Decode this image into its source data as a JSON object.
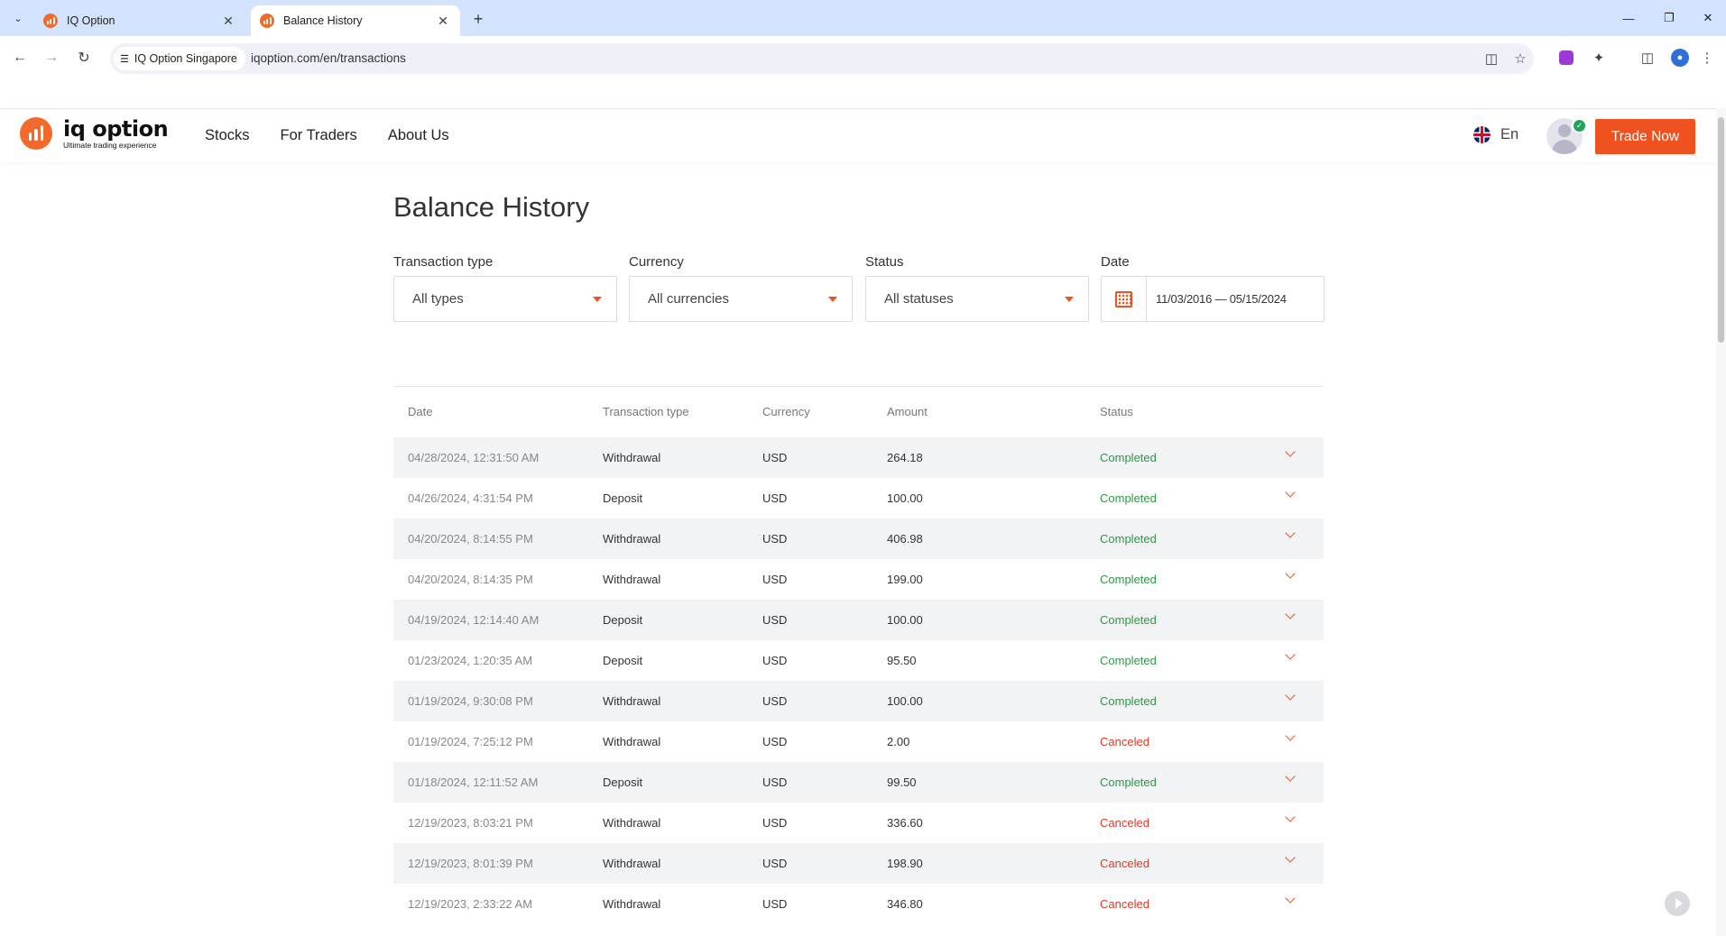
{
  "browser": {
    "tabs": [
      {
        "title": "IQ Option",
        "active": false
      },
      {
        "title": "Balance History",
        "active": true
      }
    ],
    "site_chip": "IQ Option Singapore",
    "url": "iqoption.com/en/transactions"
  },
  "header": {
    "logo_name": "iq option",
    "logo_tagline": "Ultimate trading experience",
    "nav": [
      "Stocks",
      "For Traders",
      "About Us"
    ],
    "language": "En",
    "cta": "Trade Now",
    "accent_color": "#f0521f"
  },
  "page": {
    "title": "Balance History",
    "filters": {
      "transaction_type": {
        "label": "Transaction type",
        "value": "All types"
      },
      "currency": {
        "label": "Currency",
        "value": "All currencies"
      },
      "status": {
        "label": "Status",
        "value": "All statuses"
      },
      "date": {
        "label": "Date",
        "value": "11/03/2016 — 05/15/2024"
      }
    },
    "table": {
      "headers": [
        "Date",
        "Transaction type",
        "Currency",
        "Amount",
        "Status"
      ],
      "rows": [
        {
          "date": "04/28/2024, 12:31:50 AM",
          "type": "Withdrawal",
          "currency": "USD",
          "amount": "264.18",
          "status": "Completed"
        },
        {
          "date": "04/26/2024, 4:31:54 PM",
          "type": "Deposit",
          "currency": "USD",
          "amount": "100.00",
          "status": "Completed"
        },
        {
          "date": "04/20/2024, 8:14:55 PM",
          "type": "Withdrawal",
          "currency": "USD",
          "amount": "406.98",
          "status": "Completed"
        },
        {
          "date": "04/20/2024, 8:14:35 PM",
          "type": "Withdrawal",
          "currency": "USD",
          "amount": "199.00",
          "status": "Completed"
        },
        {
          "date": "04/19/2024, 12:14:40 AM",
          "type": "Deposit",
          "currency": "USD",
          "amount": "100.00",
          "status": "Completed"
        },
        {
          "date": "01/23/2024, 1:20:35 AM",
          "type": "Deposit",
          "currency": "USD",
          "amount": "95.50",
          "status": "Completed"
        },
        {
          "date": "01/19/2024, 9:30:08 PM",
          "type": "Withdrawal",
          "currency": "USD",
          "amount": "100.00",
          "status": "Completed"
        },
        {
          "date": "01/19/2024, 7:25:12 PM",
          "type": "Withdrawal",
          "currency": "USD",
          "amount": "2.00",
          "status": "Canceled"
        },
        {
          "date": "01/18/2024, 12:11:52 AM",
          "type": "Deposit",
          "currency": "USD",
          "amount": "99.50",
          "status": "Completed"
        },
        {
          "date": "12/19/2023, 8:03:21 PM",
          "type": "Withdrawal",
          "currency": "USD",
          "amount": "336.60",
          "status": "Canceled"
        },
        {
          "date": "12/19/2023, 8:01:39 PM",
          "type": "Withdrawal",
          "currency": "USD",
          "amount": "198.90",
          "status": "Canceled"
        },
        {
          "date": "12/19/2023, 2:33:22 AM",
          "type": "Withdrawal",
          "currency": "USD",
          "amount": "346.80",
          "status": "Canceled"
        }
      ]
    },
    "status_colors": {
      "Completed": "#2b9a45",
      "Canceled": "#e03a26"
    }
  }
}
